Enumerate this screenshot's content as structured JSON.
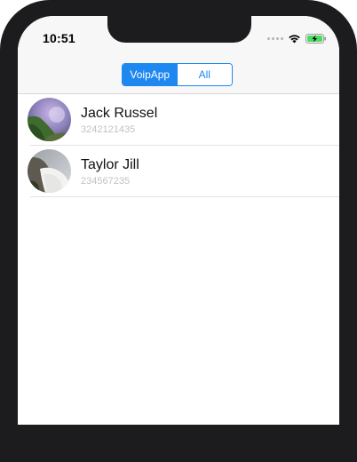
{
  "status_bar": {
    "time": "10:51",
    "icons": [
      "signal-dots-icon",
      "wifi-icon",
      "battery-charging-icon"
    ]
  },
  "segmented_control": {
    "segments": [
      {
        "label": "VoipApp",
        "selected": true
      },
      {
        "label": "All",
        "selected": false
      }
    ]
  },
  "contacts": [
    {
      "name": "Jack Russel",
      "number": "3242121435",
      "avatar": "avatar-icon"
    },
    {
      "name": "Taylor Jill",
      "number": "234567235",
      "avatar": "avatar-icon"
    }
  ],
  "colors": {
    "accent": "#1e88f0",
    "bar_background": "#f7f7f7",
    "secondary_text": "#c2c2c2",
    "separator": "#e2e2e2"
  }
}
